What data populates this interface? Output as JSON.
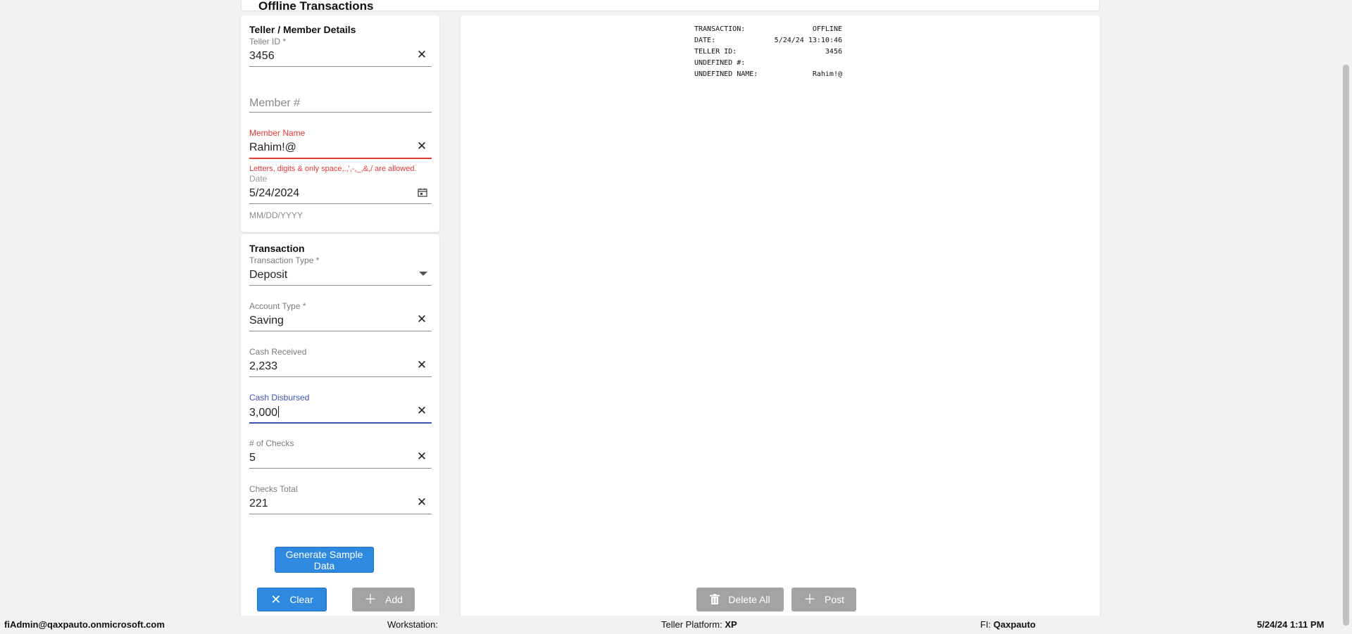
{
  "page": {
    "title": "Offline Transactions"
  },
  "member_section": {
    "title": "Teller / Member Details",
    "teller_id": {
      "label": "Teller ID *",
      "value": "3456"
    },
    "member_number": {
      "placeholder": "Member #"
    },
    "member_name": {
      "label": "Member Name",
      "value": "Rahim!@",
      "error": "Letters, digits & only space,.,',-,_,&,/ are allowed."
    },
    "date": {
      "label": "Date",
      "value": "5/24/2024",
      "helper": "MM/DD/YYYY"
    }
  },
  "transaction_section": {
    "title": "Transaction",
    "transaction_type": {
      "label": "Transaction Type *",
      "value": "Deposit"
    },
    "account_type": {
      "label": "Account Type *",
      "value": "Saving"
    },
    "cash_received": {
      "label": "Cash Received",
      "value": "2,233"
    },
    "cash_disbursed": {
      "label": "Cash Disbursed",
      "value": "3,000"
    },
    "num_checks": {
      "label": "# of Checks",
      "value": "5"
    },
    "checks_total": {
      "label": "Checks Total",
      "value": "221"
    }
  },
  "buttons": {
    "generate": "Generate Sample Data",
    "clear": "Clear",
    "add": "Add",
    "delete_all": "Delete All",
    "post": "Post"
  },
  "receipt": [
    {
      "key": "TRANSACTION:",
      "value": "OFFLINE"
    },
    {
      "key": "DATE:",
      "value": "5/24/24 13:10:46"
    },
    {
      "key": "TELLER ID:",
      "value": "3456"
    },
    {
      "key": "UNDEFINED #:",
      "value": ""
    },
    {
      "key": "UNDEFINED NAME:",
      "value": "Rahim!@"
    }
  ],
  "status_bar": {
    "user": "fiAdmin@qaxpauto.onmicrosoft.com",
    "workstation_label": "Workstation:",
    "workstation_value": "",
    "platform_label": "Teller Platform:",
    "platform_value": "XP",
    "fi_label": "FI:",
    "fi_value": "Qaxpauto",
    "datetime": "5/24/24 1:11 PM"
  },
  "colors": {
    "primary": "#2d8ae0",
    "error": "#e53935",
    "focus": "#3f51b5",
    "disabled": "#a3a3a3"
  },
  "icons": {
    "clear": "close-icon",
    "calendar": "calendar-icon",
    "dropdown": "chevron-down-icon",
    "delete": "trash-icon",
    "add": "plus-icon"
  }
}
